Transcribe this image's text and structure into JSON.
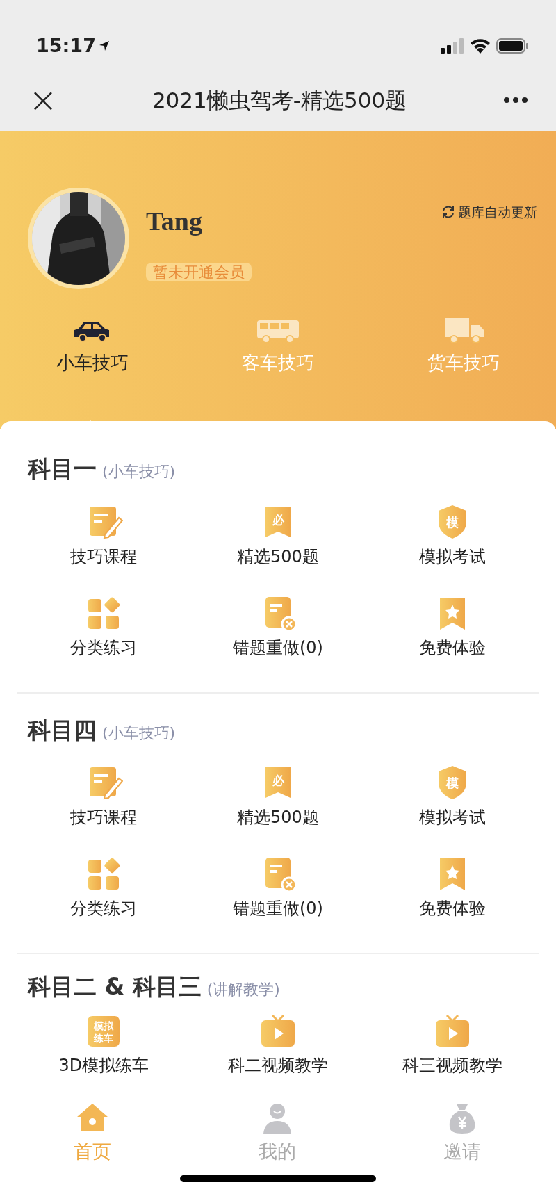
{
  "status_bar": {
    "time": "15:17"
  },
  "nav": {
    "close": "×",
    "title": "2021懒虫驾考-精选500题"
  },
  "profile": {
    "name": "Tang",
    "member_badge": "暂未开通会员",
    "update_label": "题库自动更新"
  },
  "vehicle_tabs": [
    {
      "label": "小车技巧",
      "kind": "car",
      "selected": true
    },
    {
      "label": "客车技巧",
      "kind": "bus",
      "selected": false
    },
    {
      "label": "货车技巧",
      "kind": "truck",
      "selected": false
    }
  ],
  "sections": [
    {
      "title": "科目一",
      "subtitle": "(小车技巧)",
      "items": [
        {
          "label": "技巧课程",
          "kind": "course"
        },
        {
          "label": "精选500题",
          "kind": "badge",
          "icon_text": "必"
        },
        {
          "label": "模拟考试",
          "kind": "shield",
          "icon_text": "模"
        },
        {
          "label": "分类练习",
          "kind": "category"
        },
        {
          "label": "错题重做(0)",
          "kind": "wrong"
        },
        {
          "label": "免费体验",
          "kind": "free"
        }
      ]
    },
    {
      "title": "科目四",
      "subtitle": "(小车技巧)",
      "items": [
        {
          "label": "技巧课程",
          "kind": "course"
        },
        {
          "label": "精选500题",
          "kind": "badge",
          "icon_text": "必"
        },
        {
          "label": "模拟考试",
          "kind": "shield",
          "icon_text": "模"
        },
        {
          "label": "分类练习",
          "kind": "category"
        },
        {
          "label": "错题重做(0)",
          "kind": "wrong"
        },
        {
          "label": "免费体验",
          "kind": "free"
        }
      ]
    },
    {
      "title": "科目二 & 科目三",
      "subtitle": "(讲解教学)",
      "items": [
        {
          "label": "3D模拟练车",
          "kind": "sim",
          "icon_text": "模拟练车"
        },
        {
          "label": "科二视频教学",
          "kind": "video"
        },
        {
          "label": "科三视频教学",
          "kind": "video"
        }
      ]
    }
  ],
  "tab_bar": [
    {
      "label": "首页",
      "kind": "home",
      "selected": true
    },
    {
      "label": "我的",
      "kind": "person",
      "selected": false
    },
    {
      "label": "邀请",
      "kind": "money",
      "selected": false
    }
  ]
}
